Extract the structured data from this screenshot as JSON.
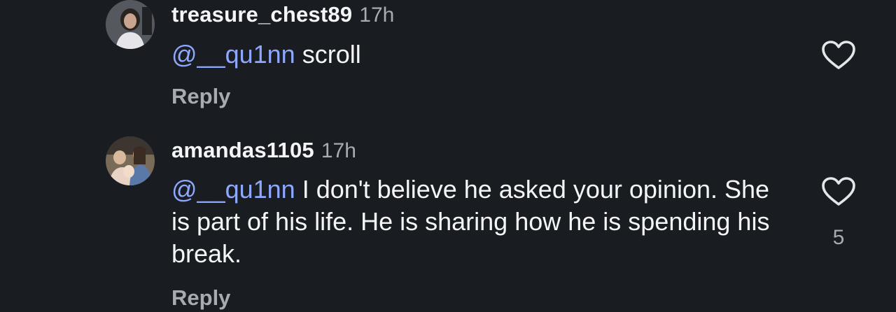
{
  "comments": [
    {
      "username": "treasure_chest89",
      "time": "17h",
      "mention": "@__qu1nn",
      "text": " scroll",
      "reply_label": "Reply",
      "like_count": "",
      "avatar_icon": "user-avatar"
    },
    {
      "username": "amandas1105",
      "time": "17h",
      "mention": "@__qu1nn",
      "text": " I don't believe he asked your opinion. She is part of his life. He is sharing how he is spending his break.",
      "reply_label": "Reply",
      "like_count": "5",
      "avatar_icon": "user-avatar"
    }
  ],
  "icons": {
    "like": "heart-outline-icon"
  },
  "colors": {
    "background": "#191c20",
    "text": "#f3f5f7",
    "secondary": "#a8abb0",
    "mention": "#8fa8ff"
  }
}
